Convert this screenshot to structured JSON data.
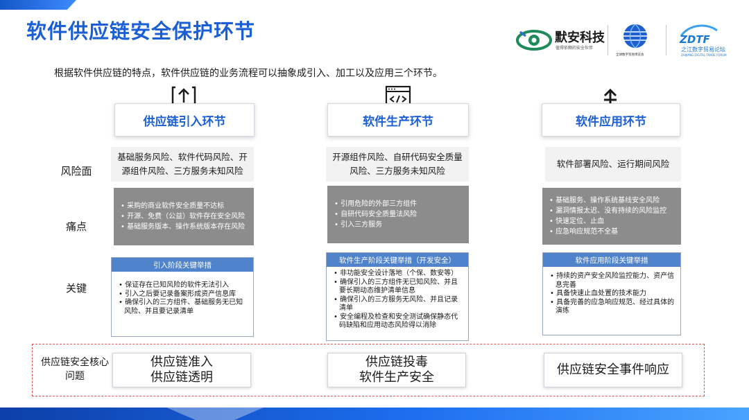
{
  "page_title": "软件供应链安全保护环节",
  "intro": "根据软件供应链的特点，软件供应链的业务流程可以抽象成引入、加工以及应用三个环节。",
  "logos": {
    "mo_name": "默安科技",
    "mo_slogan": "值得依赖的安全伙伴",
    "gdte_subtitle": "全球数字贸易博览会",
    "zdtf_mark": "ZDTF",
    "zdtf_name": "之江数字贸易论坛",
    "zdtf_subtitle": "ZHIJIANG DIGITAL TRADE FORUM"
  },
  "row_labels": {
    "risk": "风险面",
    "pain": "痛点",
    "key": "关键",
    "core": "供应链安全核心问题"
  },
  "stages": [
    {
      "header": "供应链引入环节",
      "icon": "upload-icon",
      "risk": "基础服务风险、软件代码风险、开源组件风险、三方服务未知风险",
      "pain": [
        "采购的商业软件安全质量不达标",
        "开源、免费（公益）软件存在安全风险",
        "基础服务版本、操作系统版本存在风险"
      ],
      "key_title": "引入阶段关键举措",
      "key_items": [
        "保证存在已知风险的软件无法引入",
        "引入之后要记录备案形成资产信息库",
        "确保引入的三方组件、基础服务无已知风险、并且要记录清单"
      ],
      "core": [
        "供应链准入",
        "供应链透明"
      ]
    },
    {
      "header": "软件生产环节",
      "icon": "code-window-icon",
      "risk": "开源组件风险、自研代码安全质量风险、三方服务未知风险",
      "pain": [
        "引用危险的外部三方组件",
        "自研代码安全质量法风险",
        "引入三方服务"
      ],
      "key_title": "软件生产阶段关键举措（开发安全）",
      "key_items": [
        "非功能安全设计落地（个保、数安等）",
        "确保引入的三方组件无已知风险、并且要长期动态维护清单信息",
        "确保引入的三方服务无风险、并且记录清单",
        "安全编程及检查和安全测试确保静态代码缺陷和应用动态风险得以消除"
      ],
      "core": [
        "供应链投毒",
        "软件生产安全"
      ]
    },
    {
      "header": "软件应用环节",
      "icon": "deploy-icon",
      "risk": "软件部署风险、运行期间风险",
      "pain": [
        "基础服务、操作系统基线安全风险",
        "漏洞情报太迟、没有持续的风险监控",
        "快速定位、止血",
        "应急响应规范不全基"
      ],
      "key_title": "软件应用阶段关键举措",
      "key_items": [
        "持续的资产安全风险监控能力、资产信息完善",
        "具备快速止血处置的技术能力",
        "具备完善的应急响应规范、经过具体的演练"
      ],
      "core": [
        "供应链安全事件响应"
      ]
    }
  ],
  "colors": {
    "accent": "#1b5fd6",
    "key_title_bg": "#4f83cc",
    "pain_bg": "#8c8c8c",
    "risk_bg": "#f2f2f2",
    "core_border": "#e05050"
  }
}
